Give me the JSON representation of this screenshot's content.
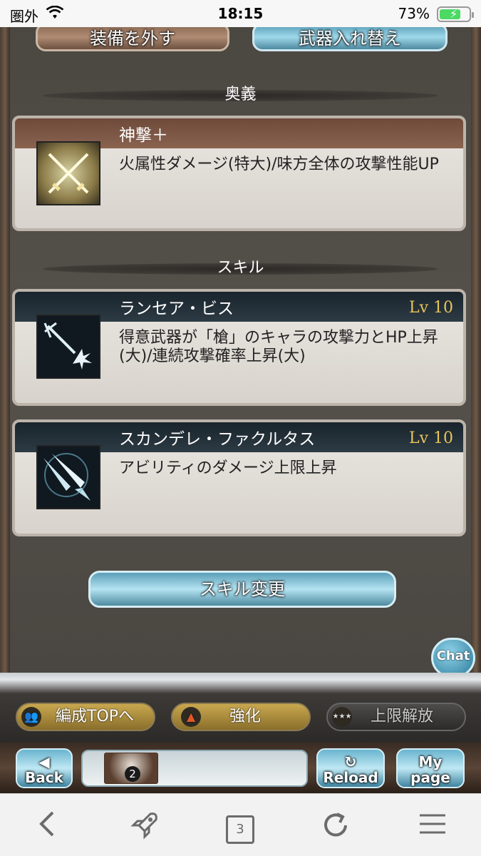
{
  "status_bar": {
    "carrier": "圏外",
    "time": "18:15",
    "battery": "73%",
    "battery_level": 0.73
  },
  "top_buttons": {
    "unequip_label": "装備を外す",
    "swap_weapon_label": "武器入れ替え"
  },
  "ougi": {
    "header": "奥義",
    "name": "神撃＋",
    "description": "火属性ダメージ(特大)/味方全体の攻撃性能UP",
    "icon": "crossed-swords-icon"
  },
  "skills": {
    "header": "スキル",
    "items": [
      {
        "name": "ランセア・ビス",
        "level": "Lv 10",
        "description": "得意武器が「槍」のキャラの攻撃力とHP上昇(大)/連続攻撃確率上昇(大)",
        "icon": "trident-spark-icon"
      },
      {
        "name": "スカンデレ・ファクルタス",
        "level": "Lv 10",
        "description": "アビリティのダメージ上限上昇",
        "icon": "twin-spears-icon"
      }
    ]
  },
  "skill_change_label": "スキル変更",
  "chat_label": "Chat",
  "bottom_buttons": {
    "party_top": "編成TOPへ",
    "upgrade": "強化",
    "limit_break": "上限解放"
  },
  "nav": {
    "back": "Back",
    "reload": "Reload",
    "mypage_line1": "My",
    "mypage_line2": "page",
    "party_count": "2"
  },
  "browser": {
    "tab_count": "3"
  }
}
